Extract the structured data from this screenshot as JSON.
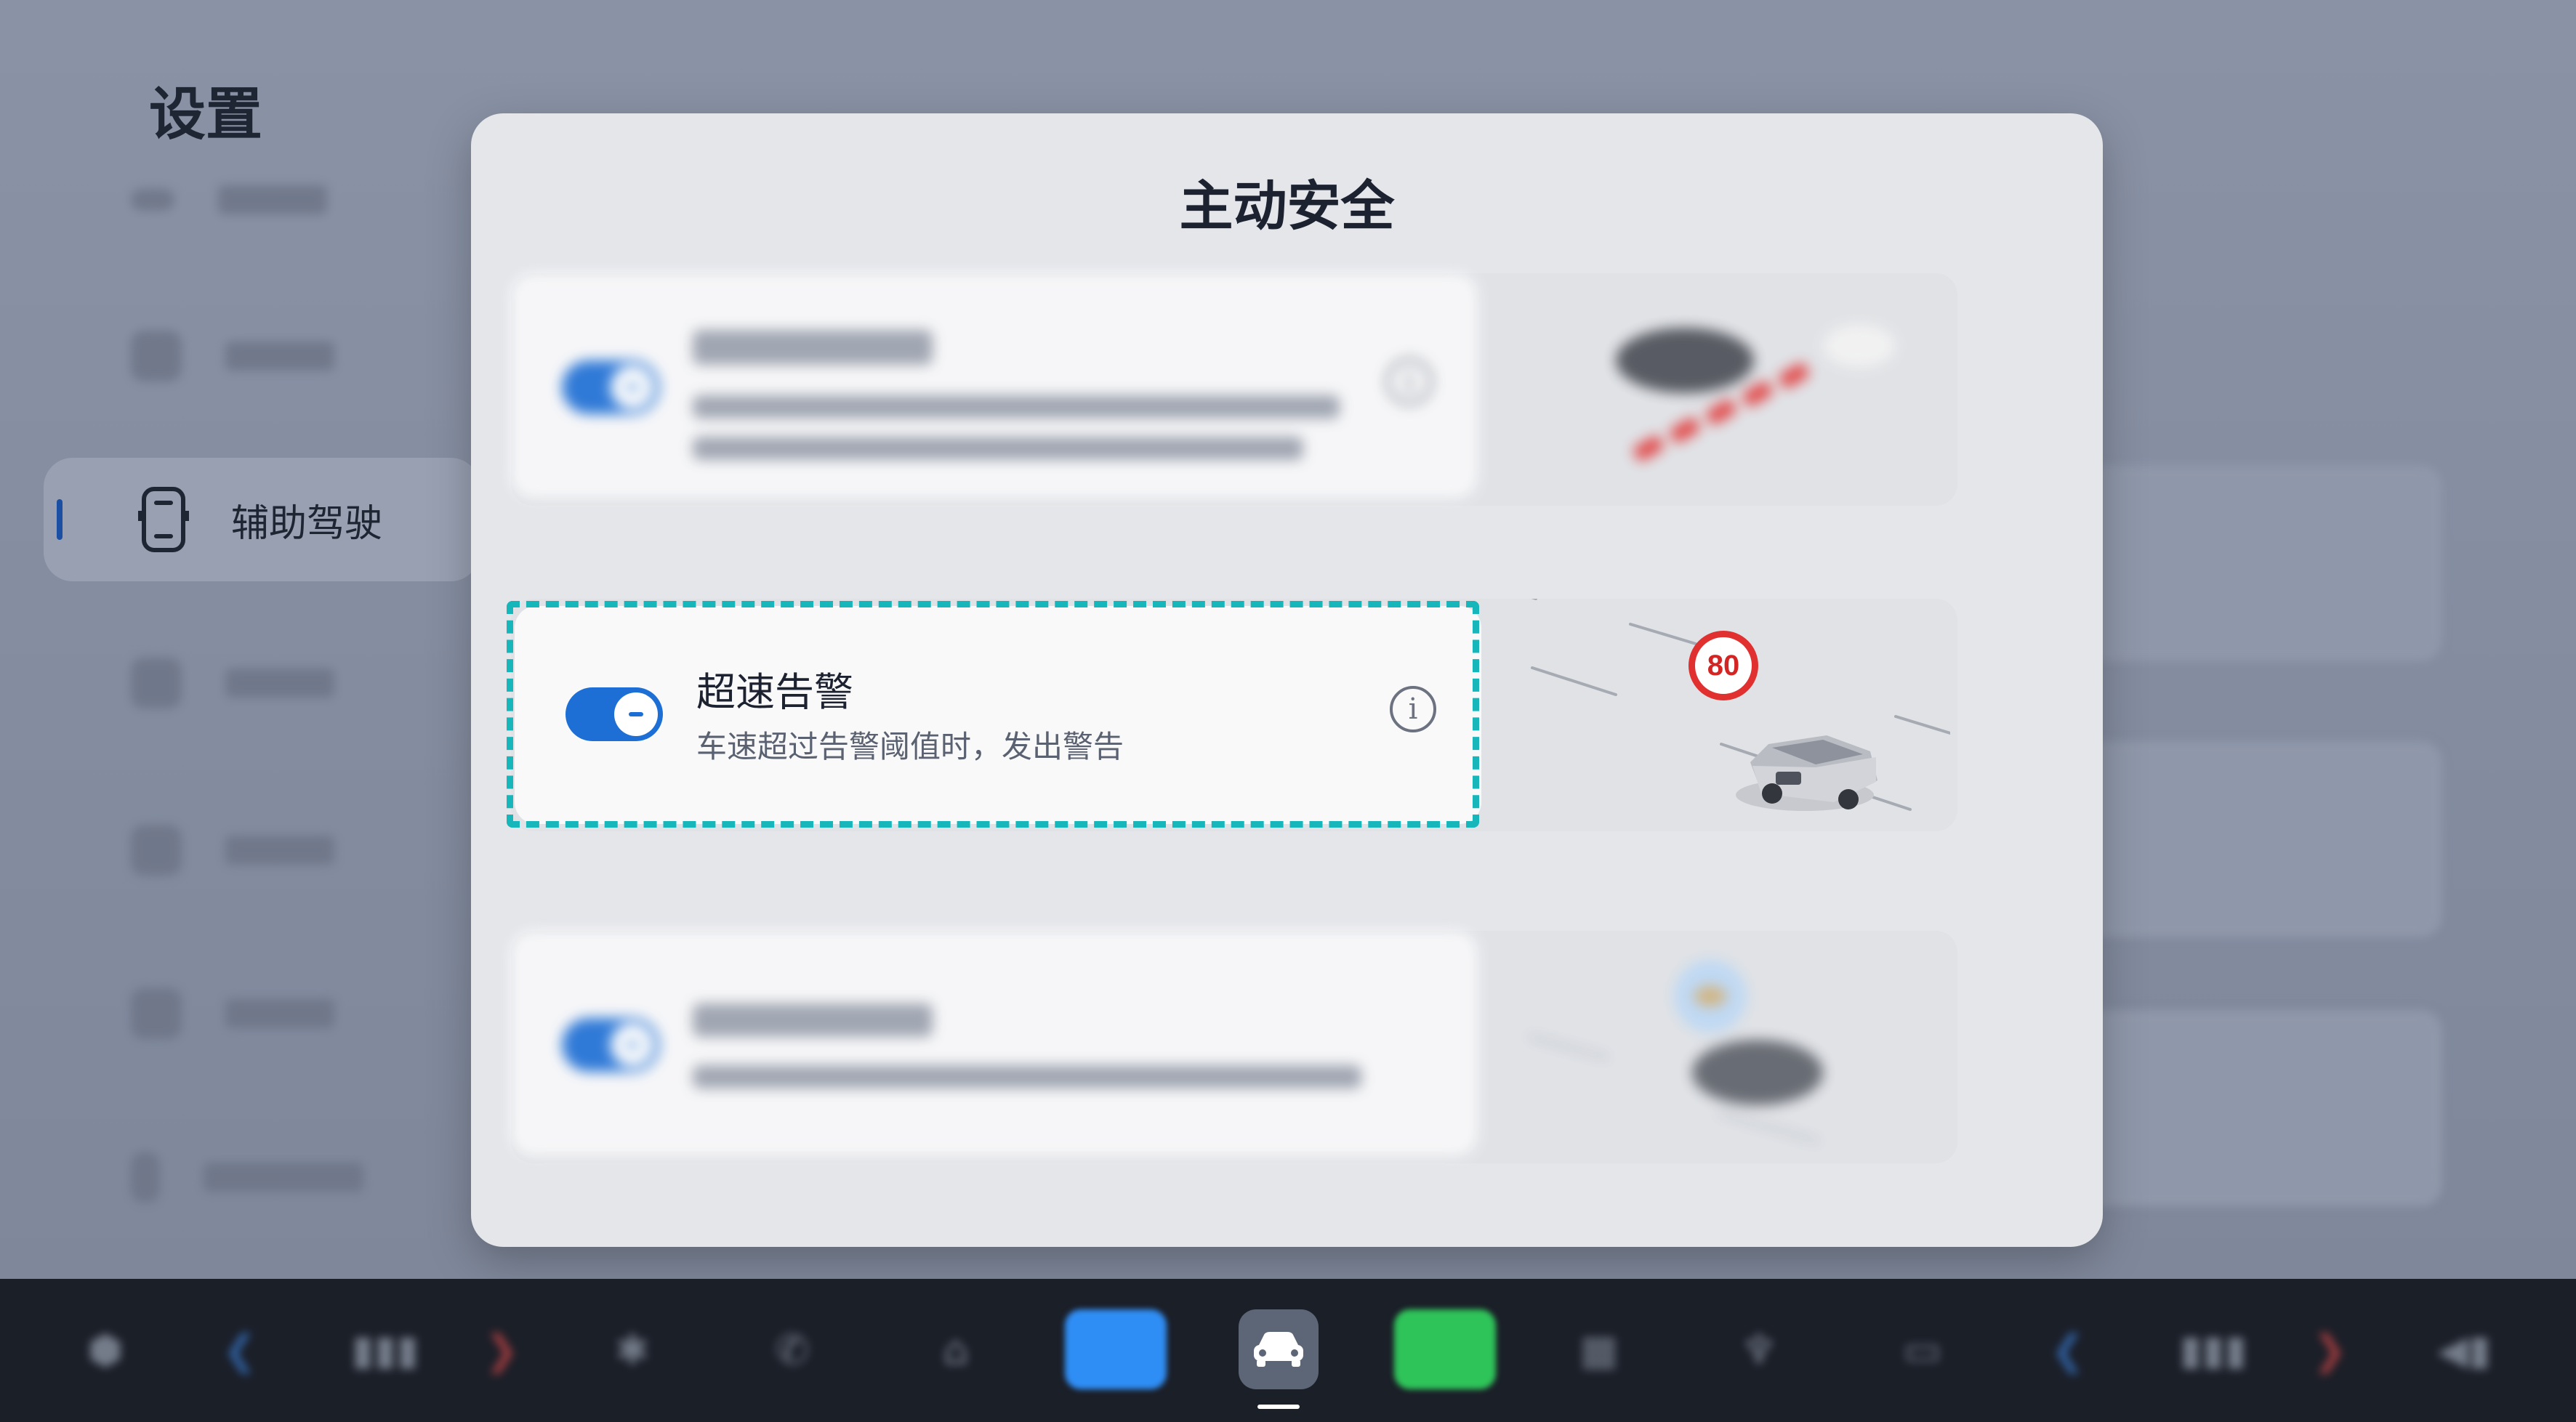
{
  "background": {
    "title": "设置",
    "active_item": "辅助驾驶"
  },
  "modal": {
    "title": "主动安全",
    "settings": [
      {
        "title": "",
        "description": "",
        "enabled": true,
        "info_icon": "info-icon"
      },
      {
        "title": "超速告警",
        "description": "车速超过告警阈值时，发出警告",
        "enabled": true,
        "info_icon": "info-icon",
        "speed_sign": "80"
      },
      {
        "title": "",
        "description": "",
        "enabled": true
      }
    ]
  },
  "dock": {
    "icons": [
      "home-icon",
      "temperature-icon",
      "fan-icon",
      "phone-icon",
      "bag-icon",
      "messages-app-icon",
      "car-app-icon",
      "phone-app-icon",
      "grid-icon",
      "seat-icon",
      "defrost-icon",
      "temperature-icon",
      "volume-icon"
    ],
    "selected": "car-app-icon"
  },
  "colors": {
    "accent_blue": "#1d6fd6",
    "focus_outline": "#16b6bb",
    "speed_sign_red": "#e03030"
  }
}
